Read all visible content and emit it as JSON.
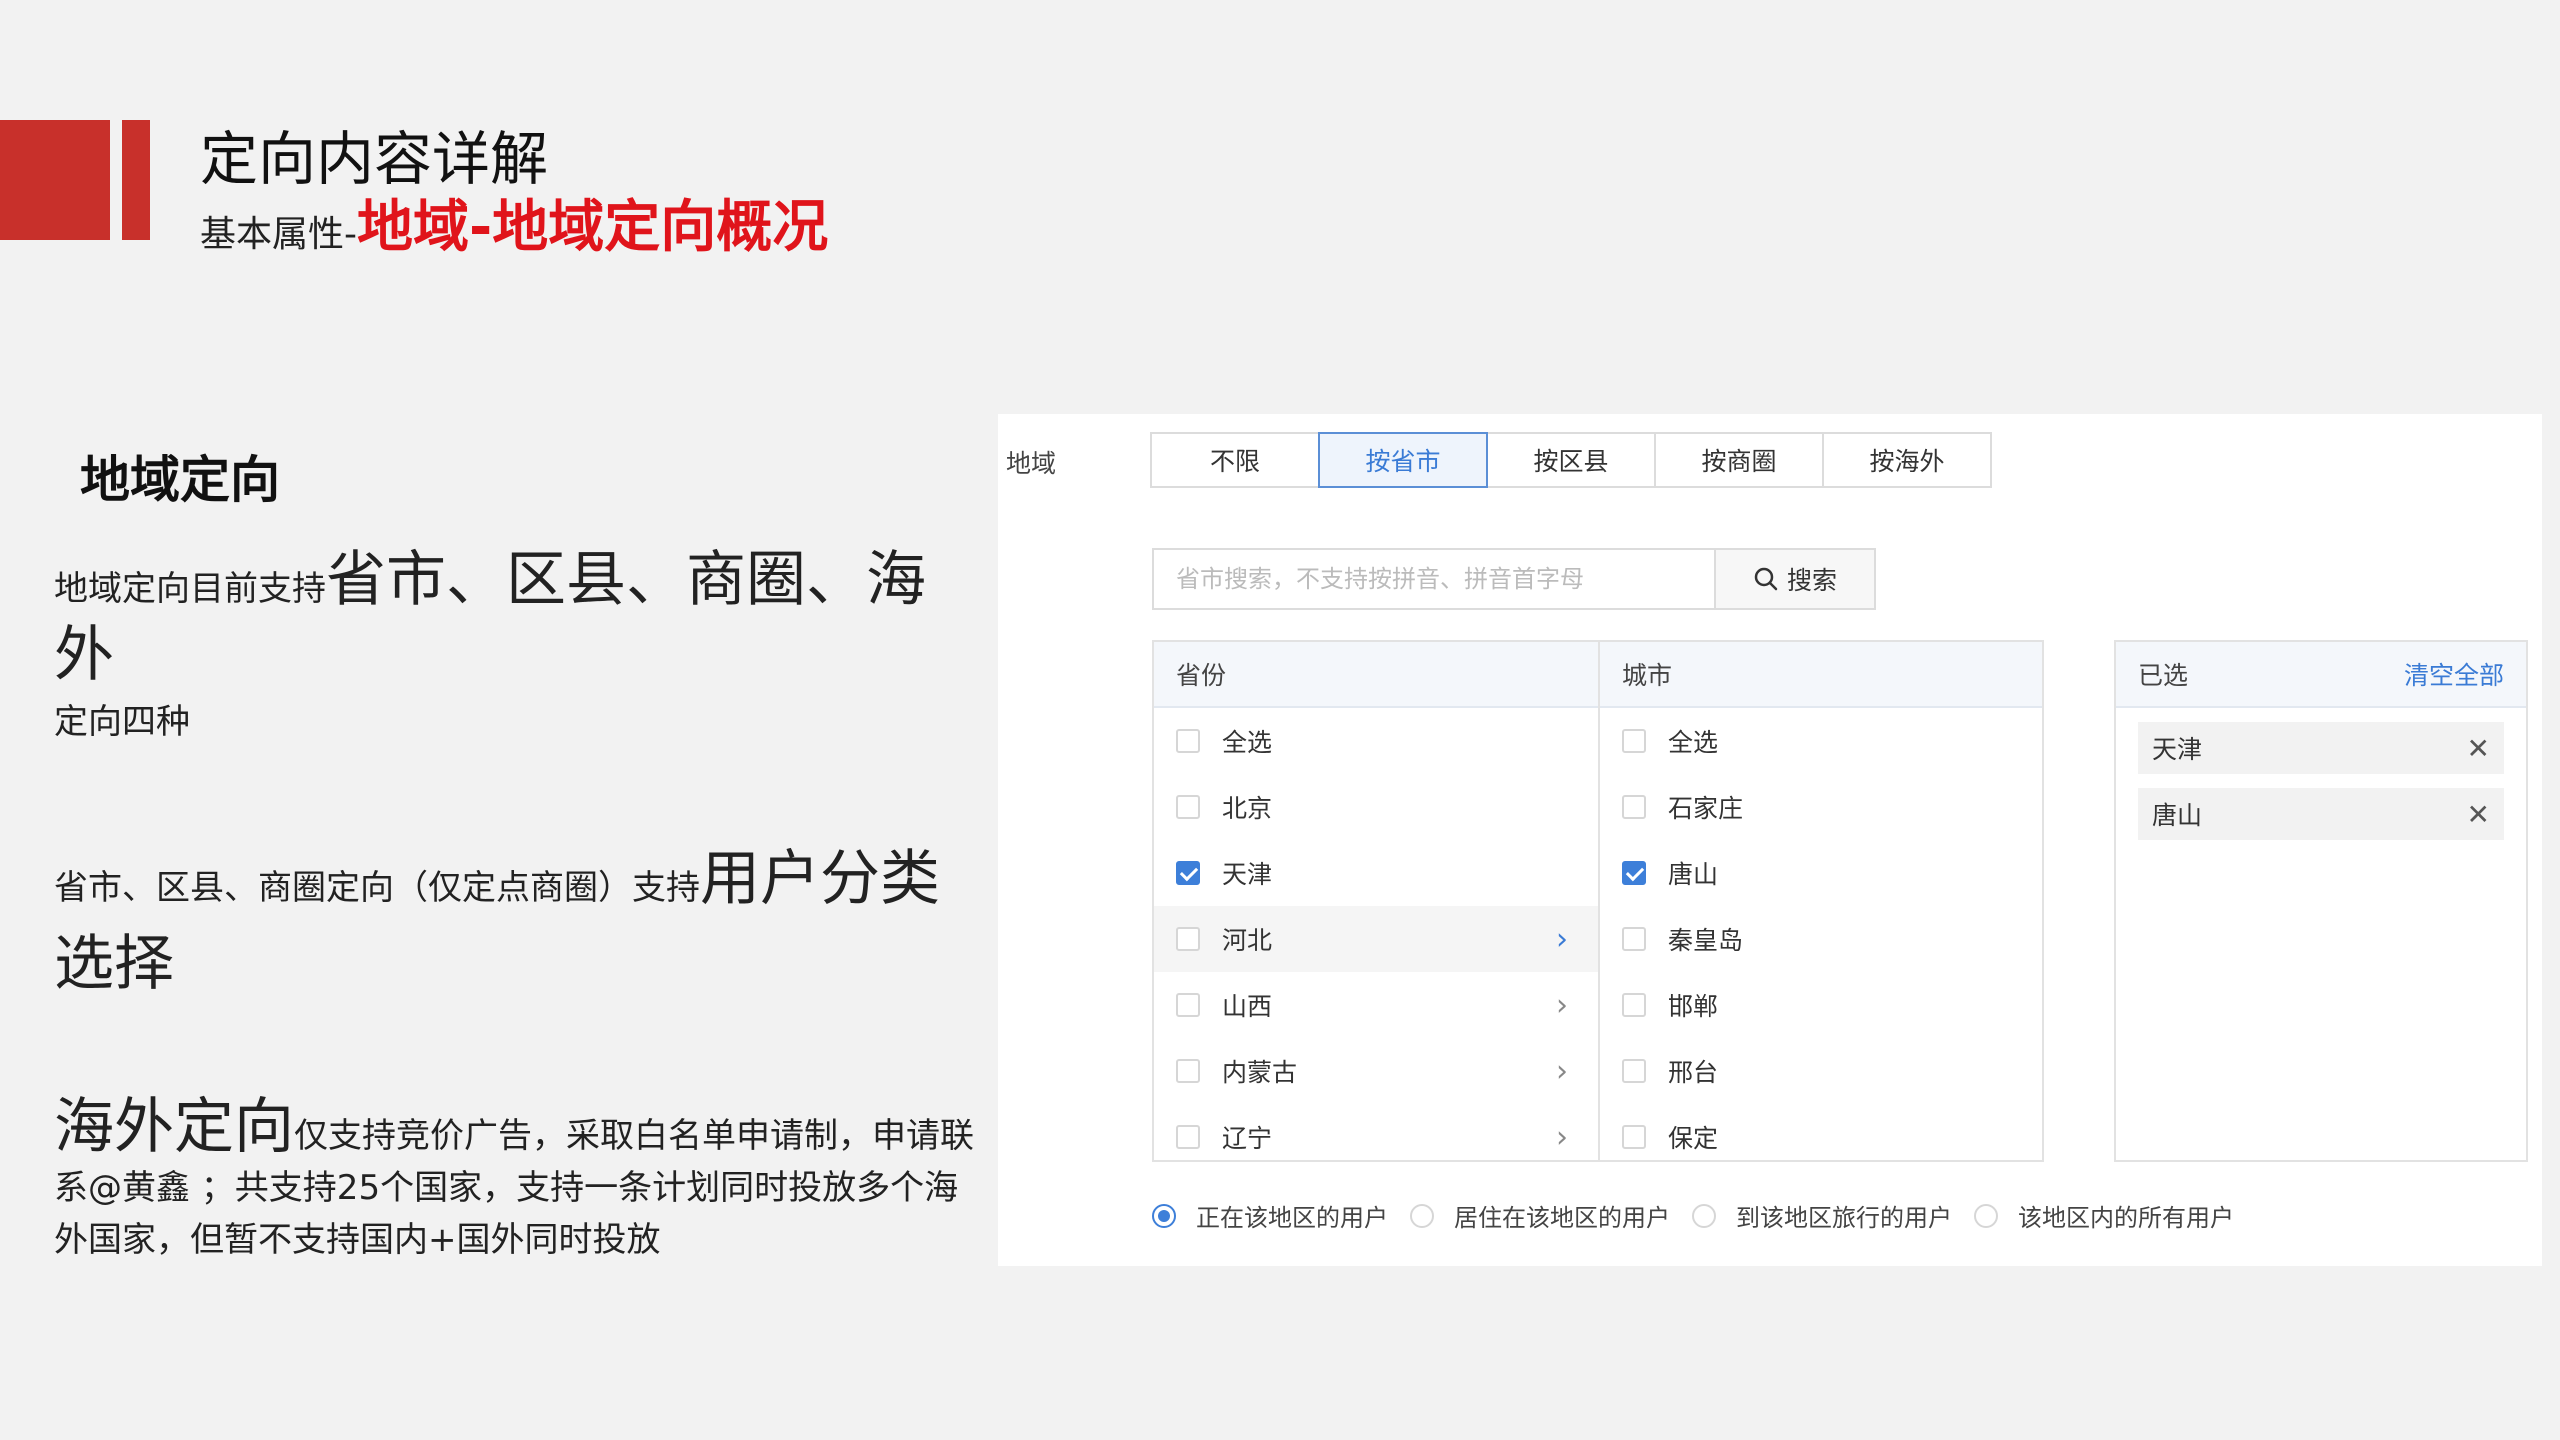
{
  "header": {
    "title": "定向内容详解",
    "subtitle_prefix": "基本属性-",
    "subtitle_highlight": "地域-地域定向概况"
  },
  "left": {
    "section_heading": "地域定向",
    "p1_small": "地域定向目前支持",
    "p1_large": "省市、区县、商圈、海外",
    "p1_tail": "定向四种",
    "p2_small": "省市、区县、商圈定向（仅定点商圈）支持",
    "p2_large": "用户分类选择",
    "p3_large": "海外定向",
    "p3_small": "仅支持竞价广告，采取白名单申请制，申请联系@黄鑫 ；共支持25个国家，支持一条计划同时投放多个海外国家，但暂不支持国内+国外同时投放"
  },
  "panel": {
    "region_label": "地域",
    "tabs": [
      "不限",
      "按省市",
      "按区县",
      "按商圈",
      "按海外"
    ],
    "active_tab": 1,
    "search_placeholder": "省市搜索，不支持按拼音、拼音首字母",
    "search_button": "搜索",
    "province_header": "省份",
    "provinces": [
      {
        "name": "全选",
        "checked": false
      },
      {
        "name": "北京",
        "checked": false
      },
      {
        "name": "天津",
        "checked": true
      },
      {
        "name": "河北",
        "checked": false
      },
      {
        "name": "山西",
        "checked": false
      },
      {
        "name": "内蒙古",
        "checked": false
      },
      {
        "name": "辽宁",
        "checked": false
      }
    ],
    "city_header": "城市",
    "cities": [
      {
        "name": "全选",
        "checked": false
      },
      {
        "name": "石家庄",
        "checked": false
      },
      {
        "name": "唐山",
        "checked": true
      },
      {
        "name": "秦皇岛",
        "checked": false
      },
      {
        "name": "邯郸",
        "checked": false
      },
      {
        "name": "邢台",
        "checked": false
      },
      {
        "name": "保定",
        "checked": false
      }
    ],
    "selected_header": "已选",
    "clear_all": "清空全部",
    "selected": [
      "天津",
      "唐山"
    ],
    "radios": [
      "正在该地区的用户",
      "居住在该地区的用户",
      "到该地区旅行的用户",
      "该地区内的所有用户"
    ],
    "radio_selected": 0
  },
  "colors": {
    "brand_red": "#c8302b",
    "highlight_red": "#e0141b",
    "accent_blue": "#3d7fd9"
  }
}
